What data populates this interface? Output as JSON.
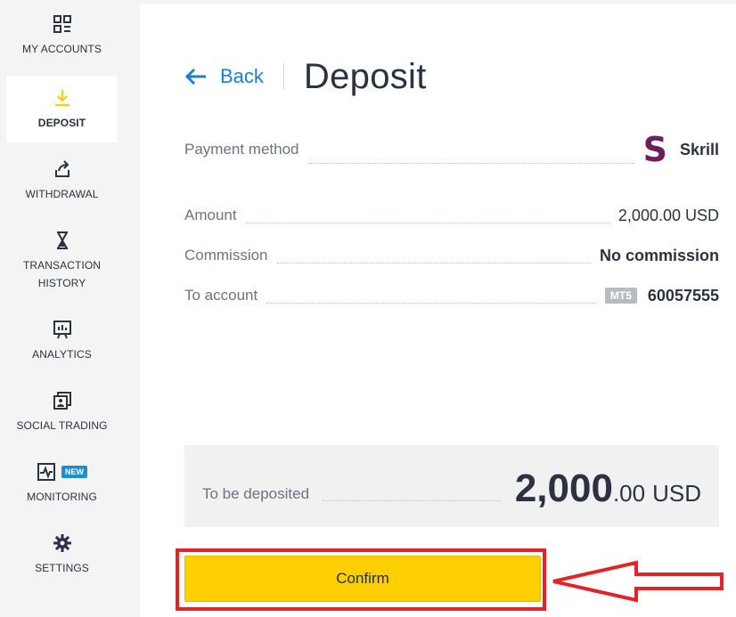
{
  "sidebar": {
    "items": [
      {
        "label": "MY ACCOUNTS",
        "icon": "accounts-icon"
      },
      {
        "label": "DEPOSIT",
        "icon": "deposit-icon",
        "active": true
      },
      {
        "label": "WITHDRAWAL",
        "icon": "withdrawal-icon"
      },
      {
        "label_line1": "TRANSACTION",
        "label_line2": "HISTORY",
        "icon": "hourglass-icon"
      },
      {
        "label": "ANALYTICS",
        "icon": "analytics-icon"
      },
      {
        "label": "SOCIAL TRADING",
        "icon": "social-trading-icon"
      },
      {
        "label": "MONITORING",
        "icon": "monitoring-icon",
        "badge": "NEW"
      },
      {
        "label": "SETTINGS",
        "icon": "gear-icon"
      }
    ]
  },
  "header": {
    "back_label": "Back",
    "title": "Deposit"
  },
  "details": {
    "payment_method_label": "Payment method",
    "payment_method_value": "Skrill",
    "payment_logo_letter": "S",
    "amount_label": "Amount",
    "amount_value": "2,000.00 USD",
    "commission_label": "Commission",
    "commission_value": "No commission",
    "to_account_label": "To account",
    "to_account_platform": "MT5",
    "to_account_value": "60057555"
  },
  "summary": {
    "label": "To be deposited",
    "amount_int": "2,000",
    "amount_dec": ".00",
    "currency": "USD"
  },
  "actions": {
    "confirm_label": "Confirm"
  },
  "colors": {
    "accent_yellow": "#ffcf01",
    "link_blue": "#1a7fd0",
    "annotation_red": "#e1242a",
    "skrill_purple": "#6b1f5d",
    "badge_blue": "#1a8fd6"
  }
}
